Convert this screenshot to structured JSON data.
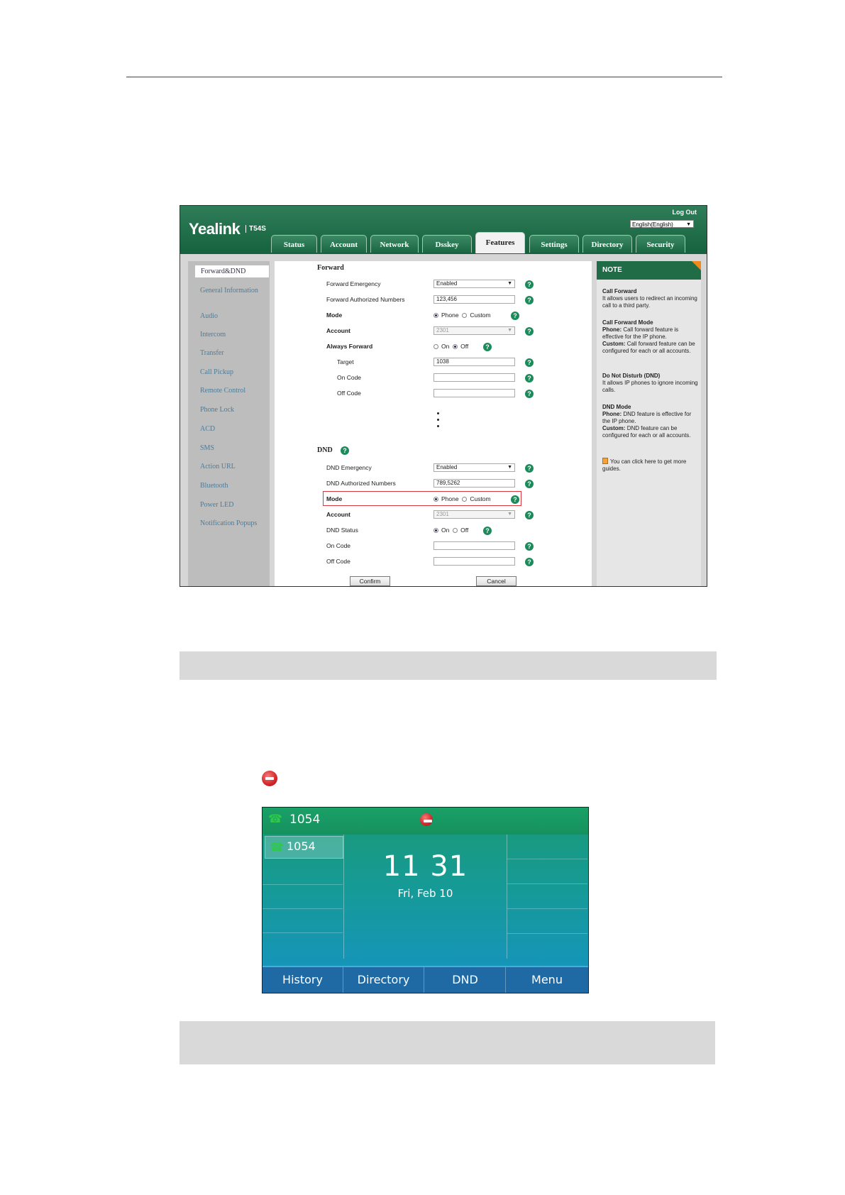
{
  "web": {
    "logo": "Yealink",
    "model": "T54S",
    "logout": "Log Out",
    "language": "English(English)",
    "tabs": [
      "Status",
      "Account",
      "Network",
      "Dsskey",
      "Features",
      "Settings",
      "Directory",
      "Security"
    ],
    "active_tab": "Features",
    "sidebar": [
      "Forward&DND",
      "General Information",
      "Audio",
      "Intercom",
      "Transfer",
      "Call Pickup",
      "Remote Control",
      "Phone Lock",
      "ACD",
      "SMS",
      "Action URL",
      "Bluetooth",
      "Power LED",
      "Notification Popups"
    ],
    "forward": {
      "title": "Forward",
      "emergency_label": "Forward Emergency",
      "emergency_value": "Enabled",
      "auth_label": "Forward Authorized Numbers",
      "auth_value": "123,456",
      "mode_label": "Mode",
      "mode_phone": "Phone",
      "mode_custom": "Custom",
      "account_label": "Account",
      "account_value": "2301",
      "always_label": "Always Forward",
      "on": "On",
      "off": "Off",
      "target_label": "Target",
      "target_value": "1038",
      "on_code_label": "On Code",
      "off_code_label": "Off Code"
    },
    "dnd": {
      "title": "DND",
      "emergency_label": "DND Emergency",
      "emergency_value": "Enabled",
      "auth_label": "DND Authorized Numbers",
      "auth_value": "789,5262",
      "mode_label": "Mode",
      "mode_phone": "Phone",
      "mode_custom": "Custom",
      "account_label": "Account",
      "account_value": "2301",
      "status_label": "DND Status",
      "on": "On",
      "off": "Off",
      "on_code_label": "On Code",
      "off_code_label": "Off Code"
    },
    "confirm": "Confirm",
    "cancel": "Cancel",
    "help_glyph": "?",
    "note": {
      "title": "NOTE",
      "cf_title": "Call Forward",
      "cf_text": "It allows users to redirect an incoming call to a third party.",
      "cfm_title": "Call Forward Mode",
      "cfm_phone_key": "Phone:",
      "cfm_phone": "Call forward feature is effective for the IP phone.",
      "cfm_custom_key": "Custom:",
      "cfm_custom": "Call forward feature can be configured for each or all accounts.",
      "dnd_title": "Do Not Disturb (DND)",
      "dnd_text": "It allows IP phones to ignore incoming calls.",
      "dndm_title": "DND Mode",
      "dndm_phone_key": "Phone:",
      "dndm_phone": "DND feature is effective for the IP phone.",
      "dndm_custom_key": "Custom:",
      "dndm_custom": "DND feature can be configured for each or all accounts.",
      "guide": "You can click here to get more guides."
    }
  },
  "phone": {
    "account": "1054",
    "line_key": "1054",
    "time": "11 31",
    "date": "Fri, Feb 10",
    "softkeys": [
      "History",
      "Directory",
      "DND",
      "Menu"
    ],
    "phone_icon_glyph": "☎"
  },
  "colors": {
    "header_green": "#1f6c47",
    "dnd_red": "#d2262a",
    "softkey_blue": "#1f6aa5",
    "highlight_red": "#d9363e"
  }
}
